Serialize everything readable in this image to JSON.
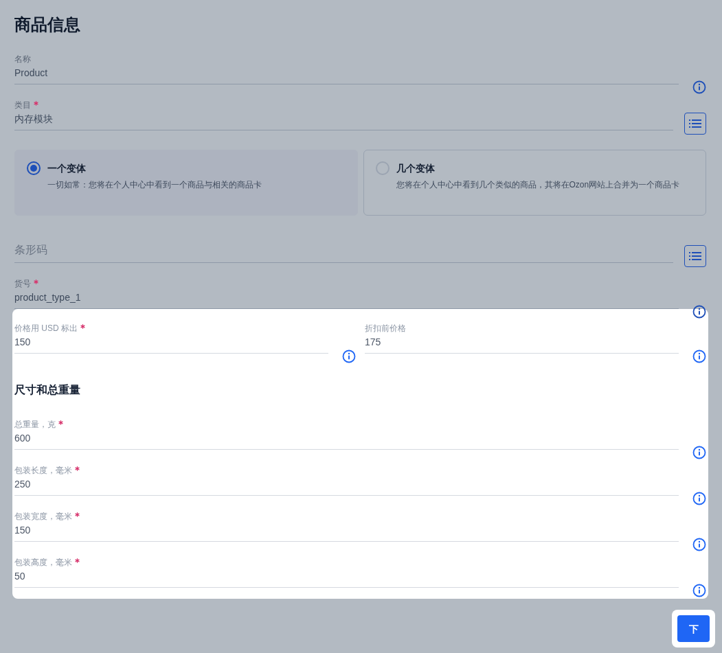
{
  "title": "商品信息",
  "top_fields": [
    {
      "kind": "info",
      "label": "名称",
      "required": false,
      "value": "Product"
    },
    {
      "kind": "list",
      "label": "类目",
      "required": true,
      "value": "内存模块"
    }
  ],
  "variants": [
    {
      "title": "一个变体",
      "description": "一切如常：您将在个人中心中看到一个商品与相关的商品卡",
      "selected": true
    },
    {
      "title": "几个变体",
      "description": "您将在个人中心中看到几个类似的商品，其将在Ozon网站上合并为一个商品卡",
      "selected": false
    }
  ],
  "middle_fields": [
    {
      "kind": "list",
      "placeholder": "条形码"
    },
    {
      "kind": "info",
      "label": "货号",
      "required": true,
      "value": "product_type_1"
    }
  ],
  "price_fields": [
    {
      "kind": "info",
      "label": "价格用 USD 标出",
      "required": true,
      "value": "150"
    },
    {
      "kind": "info",
      "label": "折扣前价格",
      "required": false,
      "value": "175"
    }
  ],
  "dimensions": {
    "title": "尺寸和总重量",
    "fields": [
      {
        "kind": "info",
        "label": "总重量，克",
        "required": true,
        "value": "600"
      },
      {
        "kind": "info",
        "label": "包装长度，毫米",
        "required": true,
        "value": "250"
      },
      {
        "kind": "info",
        "label": "包装宽度，毫米",
        "required": true,
        "value": "150"
      },
      {
        "kind": "info",
        "label": "包装高度，毫米",
        "required": true,
        "value": "50"
      }
    ]
  },
  "next_button": "下"
}
